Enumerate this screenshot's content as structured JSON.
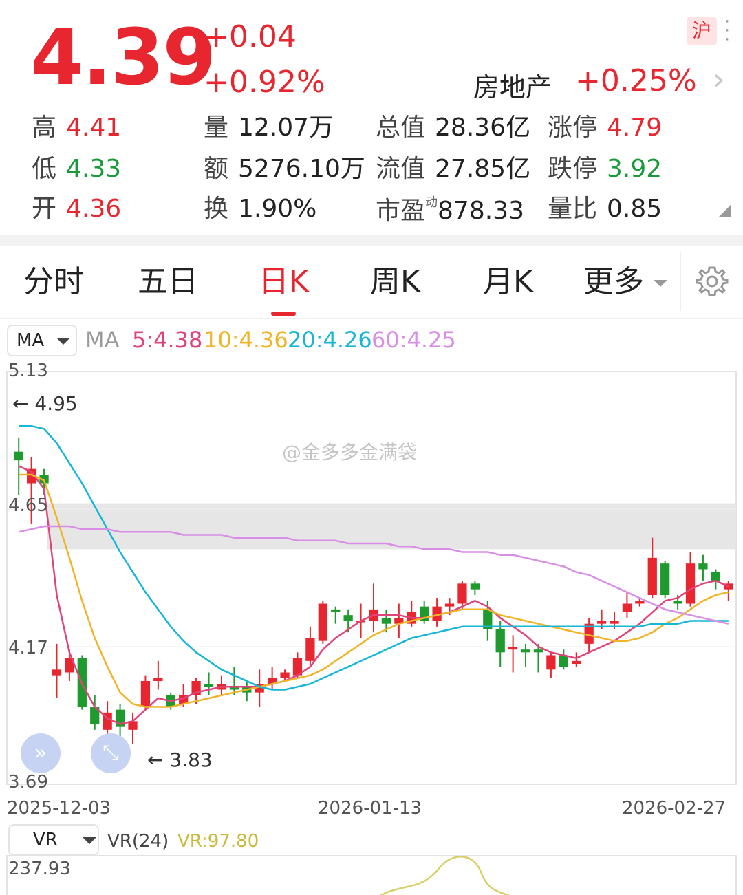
{
  "quote": {
    "price": "4.39",
    "change": "+0.04",
    "change_pct": "+0.92%",
    "market_badge": "沪",
    "sector_name": "房地产",
    "sector_change": "+0.25%"
  },
  "stats": [
    {
      "label": "高",
      "value": "4.41",
      "color": "red"
    },
    {
      "label": "低",
      "value": "4.33",
      "color": "green"
    },
    {
      "label": "开",
      "value": "4.36",
      "color": "red"
    },
    {
      "label": "量",
      "value": "12.07万",
      "color": "dark"
    },
    {
      "label": "额",
      "value": "5276.10万",
      "color": "dark"
    },
    {
      "label": "换",
      "value": "1.90%",
      "color": "dark"
    },
    {
      "label": "总值",
      "value": "28.36亿",
      "color": "dark"
    },
    {
      "label": "流值",
      "value": "27.85亿",
      "color": "dark"
    },
    {
      "label": "市盈",
      "sup": "动",
      "value": "878.33",
      "color": "dark"
    },
    {
      "label": "涨停",
      "value": "4.79",
      "color": "red"
    },
    {
      "label": "跌停",
      "value": "3.92",
      "color": "green"
    },
    {
      "label": "量比",
      "value": "0.85",
      "color": "dark"
    }
  ],
  "tabs": [
    "分时",
    "五日",
    "日K",
    "周K",
    "月K",
    "更多"
  ],
  "active_tab": "日K",
  "indicator": {
    "select_label": "MA",
    "name": "MA",
    "items": [
      {
        "text": "5:4.38",
        "color": "#e0447a"
      },
      {
        "text": "10:4.36",
        "color": "#f0b429"
      },
      {
        "text": "20:4.26",
        "color": "#16b6d6"
      },
      {
        "text": "60:4.25",
        "color": "#d98ee6"
      }
    ]
  },
  "watermark": "@金多多金满袋",
  "chart_data": {
    "type": "candlestick",
    "y_axis_ticks": [
      "5.13",
      "4.65",
      "4.17",
      "3.69"
    ],
    "ylim": [
      3.69,
      5.13
    ],
    "x_axis_ticks": [
      "2025-12-03",
      "2026-01-13",
      "2026-02-27"
    ],
    "high_marker": "4.95",
    "low_marker": "3.83",
    "candles": [
      [
        4.85,
        4.82,
        4.9,
        4.7
      ],
      [
        4.74,
        4.79,
        4.83,
        4.6
      ],
      [
        4.77,
        4.74,
        4.79,
        4.7
      ],
      [
        4.07,
        4.09,
        4.18,
        3.99
      ],
      [
        4.08,
        4.13,
        4.16,
        4.05
      ],
      [
        4.13,
        3.96,
        4.14,
        3.95
      ],
      [
        3.96,
        3.9,
        4.0,
        3.88
      ],
      [
        3.88,
        3.94,
        3.98,
        3.84
      ],
      [
        3.95,
        3.89,
        3.97,
        3.85
      ],
      [
        3.88,
        3.91,
        3.94,
        3.83
      ],
      [
        3.96,
        4.05,
        4.07,
        3.95
      ],
      [
        4.05,
        4.06,
        4.12,
        4.02
      ],
      [
        4.0,
        3.96,
        4.01,
        3.95
      ],
      [
        3.97,
        4.0,
        4.04,
        3.96
      ],
      [
        4.0,
        4.05,
        4.06,
        3.97
      ],
      [
        4.04,
        4.03,
        4.08,
        4.0
      ],
      [
        4.02,
        4.04,
        4.07,
        4.0
      ],
      [
        4.03,
        4.02,
        4.1,
        4.0
      ],
      [
        4.03,
        4.01,
        4.05,
        3.98
      ],
      [
        4.01,
        4.04,
        4.09,
        3.96
      ],
      [
        4.04,
        4.06,
        4.1,
        4.02
      ],
      [
        4.06,
        4.08,
        4.09,
        4.05
      ],
      [
        4.07,
        4.13,
        4.15,
        4.06
      ],
      [
        4.12,
        4.2,
        4.24,
        4.1
      ],
      [
        4.19,
        4.32,
        4.33,
        4.18
      ],
      [
        4.3,
        4.29,
        4.31,
        4.25
      ],
      [
        4.28,
        4.26,
        4.3,
        4.22
      ],
      [
        4.26,
        4.26,
        4.32,
        4.2
      ],
      [
        4.26,
        4.3,
        4.39,
        4.22
      ],
      [
        4.27,
        4.25,
        4.3,
        4.22
      ],
      [
        4.25,
        4.27,
        4.32,
        4.2
      ],
      [
        4.25,
        4.29,
        4.33,
        4.24
      ],
      [
        4.31,
        4.26,
        4.33,
        4.25
      ],
      [
        4.26,
        4.31,
        4.34,
        4.24
      ],
      [
        4.31,
        4.32,
        4.34,
        4.28
      ],
      [
        4.32,
        4.39,
        4.4,
        4.3
      ],
      [
        4.39,
        4.37,
        4.4,
        4.35
      ],
      [
        4.3,
        4.23,
        4.33,
        4.19
      ],
      [
        4.23,
        4.15,
        4.26,
        4.1
      ],
      [
        4.16,
        4.17,
        4.21,
        4.08
      ],
      [
        4.16,
        4.15,
        4.18,
        4.1
      ],
      [
        4.16,
        4.15,
        4.18,
        4.08
      ],
      [
        4.09,
        4.14,
        4.15,
        4.06
      ],
      [
        4.14,
        4.1,
        4.16,
        4.09
      ],
      [
        4.11,
        4.12,
        4.15,
        4.1
      ],
      [
        4.18,
        4.25,
        4.27,
        4.15
      ],
      [
        4.25,
        4.26,
        4.3,
        4.23
      ],
      [
        4.25,
        4.26,
        4.29,
        4.23
      ],
      [
        4.29,
        4.32,
        4.36,
        4.27
      ],
      [
        4.32,
        4.33,
        4.34,
        4.31
      ],
      [
        4.35,
        4.48,
        4.55,
        4.34
      ],
      [
        4.46,
        4.35,
        4.47,
        4.34
      ],
      [
        4.33,
        4.32,
        4.35,
        4.3
      ],
      [
        4.32,
        4.46,
        4.5,
        4.31
      ],
      [
        4.46,
        4.44,
        4.49,
        4.4
      ],
      [
        4.43,
        4.4,
        4.44,
        4.37
      ],
      [
        4.37,
        4.39,
        4.4,
        4.33
      ]
    ],
    "series": [
      {
        "name": "5",
        "values": [
          4.8,
          4.78,
          4.72,
          4.35,
          4.15,
          4.04,
          3.96,
          3.92,
          3.9,
          3.91,
          3.95,
          3.99,
          3.98,
          3.99,
          4.01,
          4.02,
          4.03,
          4.03,
          4.03,
          4.03,
          4.04,
          4.05,
          4.07,
          4.1,
          4.16,
          4.2,
          4.23,
          4.26,
          4.28,
          4.28,
          4.28,
          4.27,
          4.27,
          4.28,
          4.29,
          4.31,
          4.33,
          4.31,
          4.27,
          4.24,
          4.21,
          4.17,
          4.15,
          4.14,
          4.13,
          4.15,
          4.17,
          4.19,
          4.22,
          4.25,
          4.29,
          4.33,
          4.34,
          4.37,
          4.39,
          4.4,
          4.38
        ]
      },
      {
        "name": "10",
        "values": [
          4.77,
          4.77,
          4.75,
          4.62,
          4.48,
          4.33,
          4.2,
          4.1,
          4.01,
          3.97,
          3.96,
          3.96,
          3.96,
          3.97,
          3.98,
          3.99,
          4.0,
          4.01,
          4.02,
          4.03,
          4.04,
          4.05,
          4.06,
          4.07,
          4.09,
          4.12,
          4.15,
          4.18,
          4.21,
          4.23,
          4.25,
          4.26,
          4.27,
          4.28,
          4.29,
          4.3,
          4.3,
          4.3,
          4.28,
          4.27,
          4.26,
          4.25,
          4.24,
          4.23,
          4.22,
          4.21,
          4.2,
          4.19,
          4.19,
          4.2,
          4.22,
          4.25,
          4.27,
          4.3,
          4.33,
          4.35,
          4.36
        ]
      },
      {
        "name": "20",
        "values": [
          4.94,
          4.94,
          4.93,
          4.88,
          4.81,
          4.74,
          4.66,
          4.58,
          4.5,
          4.43,
          4.36,
          4.3,
          4.24,
          4.19,
          4.15,
          4.12,
          4.09,
          4.07,
          4.05,
          4.03,
          4.02,
          4.02,
          4.03,
          4.04,
          4.06,
          4.08,
          4.1,
          4.12,
          4.14,
          4.16,
          4.18,
          4.2,
          4.21,
          4.22,
          4.23,
          4.24,
          4.24,
          4.24,
          4.24,
          4.24,
          4.24,
          4.24,
          4.24,
          4.24,
          4.24,
          4.24,
          4.24,
          4.24,
          4.24,
          4.24,
          4.25,
          4.25,
          4.25,
          4.26,
          4.26,
          4.26,
          4.26
        ]
      },
      {
        "name": "60",
        "values": [
          4.57,
          4.58,
          4.59,
          4.59,
          4.59,
          4.58,
          4.58,
          4.58,
          4.57,
          4.57,
          4.57,
          4.57,
          4.57,
          4.56,
          4.56,
          4.56,
          4.56,
          4.55,
          4.55,
          4.55,
          4.55,
          4.55,
          4.54,
          4.54,
          4.54,
          4.54,
          4.53,
          4.53,
          4.53,
          4.53,
          4.52,
          4.52,
          4.51,
          4.51,
          4.51,
          4.5,
          4.5,
          4.5,
          4.49,
          4.49,
          4.48,
          4.47,
          4.46,
          4.45,
          4.43,
          4.42,
          4.4,
          4.38,
          4.36,
          4.34,
          4.32,
          4.3,
          4.29,
          4.28,
          4.27,
          4.26,
          4.25
        ]
      }
    ],
    "colors": {
      "up": "#e8262f",
      "down": "#1e9a2e",
      "ma5": "#e0447a",
      "ma10": "#f0b429",
      "ma20": "#16b6d6",
      "ma60": "#d98ee6"
    }
  },
  "volume_indicator": {
    "select_label": "VR",
    "name": "VR(24)",
    "value": "VR:97.80",
    "value_color": "#c9ba3c",
    "top_tick": "237.93"
  }
}
